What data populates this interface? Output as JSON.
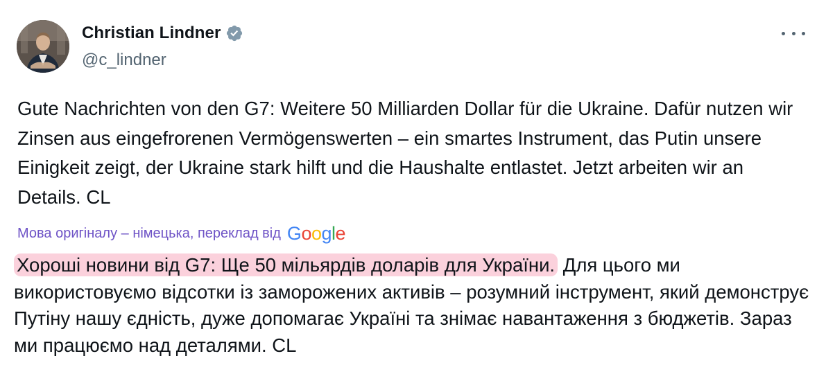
{
  "author": {
    "name": "Christian Lindner",
    "handle": "@c_lindner",
    "verified": true,
    "avatar_icon": "profile-photo"
  },
  "menu_icon": "more-options-icon",
  "tweet": {
    "text": "Gute Nachrichten von den G7: Weitere 50 Milliarden Dollar für die Ukraine. Dafür nutzen wir Zinsen aus eingefrorenen Vermögenswerten – ein smartes Instrument, das Putin unsere Einigkeit zeigt, der Ukraine stark hilft und die Haushalte entlastet. Jetzt arbeiten wir an Details. CL"
  },
  "translation": {
    "note": "Мова оригіналу – німецька, переклад від",
    "provider": "Google",
    "highlighted": "Хороші новини від G7: Ще 50 мільярдів доларів для України.",
    "rest": " Для цього ми використовуємо відсотки із заморожених активів – розумний інструмент, який демонструє Путіну нашу єдність, дуже допомагає Україні та знімає навантаження з бюджетів. Зараз ми працюємо над деталями. CL"
  },
  "colors": {
    "verified": "#829aab",
    "translate_note": "#6e53c6",
    "highlight": "#fbd1dc",
    "google_blue": "#4285F4",
    "google_red": "#EA4335",
    "google_yellow": "#FBBC05",
    "google_green": "#34A853"
  }
}
